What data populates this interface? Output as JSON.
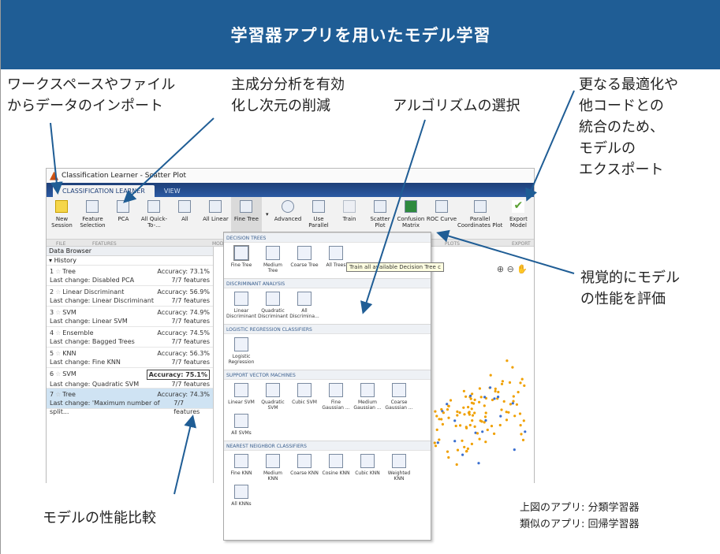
{
  "banner": {
    "title": "学習器アプリを用いたモデル学習"
  },
  "annotations": {
    "import": "ワークスペースやファイル\nからデータのインポート",
    "pca": "主成分分析を有効\n化し次元の削減",
    "algorithm": "アルゴリズムの選択",
    "export": "更なる最適化や\n他コードとの\n統合のため、\nモデルの\nエクスポート",
    "evaluate": "視覚的にモデル\nの性能を評価",
    "compare": "モデルの性能比較"
  },
  "notes": {
    "line1": "上図のアプリ: 分類学習器",
    "line2": "類似のアプリ: 回帰学習器"
  },
  "window": {
    "title": "Classification Learner - Scatter Plot",
    "tabs": [
      "CLASSIFICATION LEARNER",
      "VIEW"
    ],
    "ribbon": [
      "New Session",
      "Feature Selection",
      "PCA",
      "All Quick-To-...",
      "All",
      "All Linear",
      "Fine Tree",
      "Advanced",
      "Use Parallel",
      "Train",
      "Scatter Plot",
      "Confusion Matrix",
      "ROC Curve",
      "Parallel Coordinates Plot",
      "Export Model"
    ],
    "sections": [
      "FILE",
      "FEATURES",
      "MOD",
      "PLOTS",
      "EXPORT"
    ]
  },
  "browser": {
    "title": "Data Browser",
    "history_label": "History",
    "models": [
      {
        "num": "1",
        "name": "Tree",
        "accuracy": "Accuracy: 73.1%",
        "change": "Last change: Disabled PCA",
        "features": "7/7 features"
      },
      {
        "num": "2",
        "name": "Linear Discriminant",
        "accuracy": "Accuracy: 56.9%",
        "change": "Last change: Linear Discriminant",
        "features": "7/7 features"
      },
      {
        "num": "3",
        "name": "SVM",
        "accuracy": "Accuracy: 74.9%",
        "change": "Last change: Linear SVM",
        "features": "7/7 features"
      },
      {
        "num": "4",
        "name": "Ensemble",
        "accuracy": "Accuracy: 74.5%",
        "change": "Last change: Bagged Trees",
        "features": "7/7 features"
      },
      {
        "num": "5",
        "name": "KNN",
        "accuracy": "Accuracy: 56.3%",
        "change": "Last change: Fine KNN",
        "features": "7/7 features"
      },
      {
        "num": "6",
        "name": "SVM",
        "accuracy": "Accuracy: 75.1%",
        "change": "Last change: Quadratic SVM",
        "features": "7/7 features"
      },
      {
        "num": "7",
        "name": "Tree",
        "accuracy": "Accuracy: 74.3%",
        "change": "Last change: 'Maximum number of split...",
        "features": "7/7 features"
      }
    ]
  },
  "gallery": {
    "tooltip": "Train all available Decision Tree c",
    "sections": [
      {
        "title": "DECISION TREES",
        "items": [
          "Fine Tree",
          "Medium Tree",
          "Coarse Tree",
          "All Trees"
        ]
      },
      {
        "title": "DISCRIMINANT ANALYSIS",
        "items": [
          "Linear Discriminant",
          "Quadratic Discriminant",
          "All Discrimina..."
        ]
      },
      {
        "title": "LOGISTIC REGRESSION CLASSIFIERS",
        "items": [
          "Logistic Regression"
        ]
      },
      {
        "title": "SUPPORT VECTOR MACHINES",
        "items": [
          "Linear SVM",
          "Quadratic SVM",
          "Cubic SVM",
          "Fine Gaussian ...",
          "Medium Gaussian ...",
          "Coarse Gaussian ...",
          "All SVMs"
        ]
      },
      {
        "title": "NEAREST NEIGHBOR CLASSIFIERS",
        "items": [
          "Fine KNN",
          "Medium KNN",
          "Coarse KNN",
          "Cosine KNN",
          "Cubic KNN",
          "Weighted KNN",
          "All KNNs"
        ]
      }
    ]
  },
  "colors": {
    "banner": "#1f5d95",
    "arrow": "#1f5d95",
    "ribbon_tab": "#2b5aa3",
    "selected_row": "#cfe3f3",
    "dots_orange": "#f0a000"
  }
}
